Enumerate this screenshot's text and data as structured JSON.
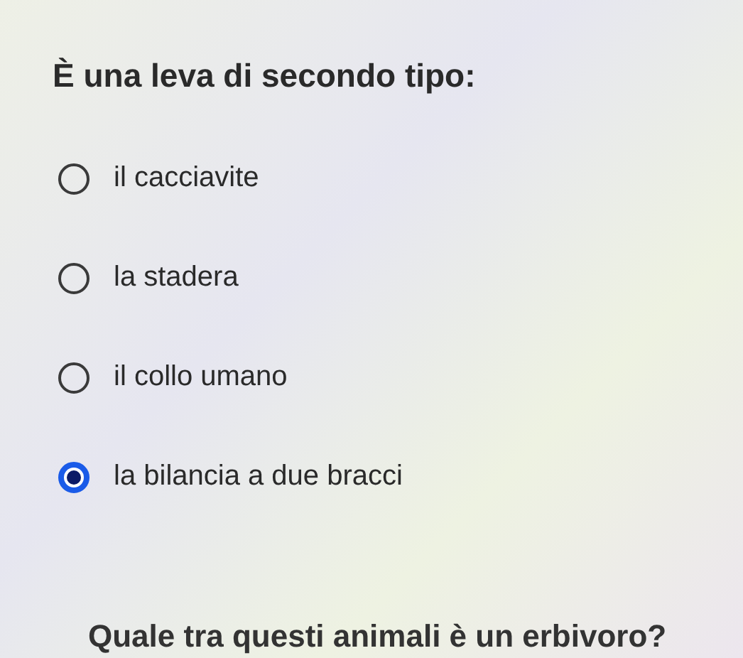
{
  "question": {
    "title": "È una leva di secondo tipo:",
    "options": [
      {
        "label": "il cacciavite",
        "selected": false
      },
      {
        "label": "la stadera",
        "selected": false
      },
      {
        "label": "il collo umano",
        "selected": false
      },
      {
        "label": "la bilancia a due bracci",
        "selected": true
      }
    ]
  },
  "next_question": {
    "title": "Quale tra questi animali è un erbivoro?"
  }
}
